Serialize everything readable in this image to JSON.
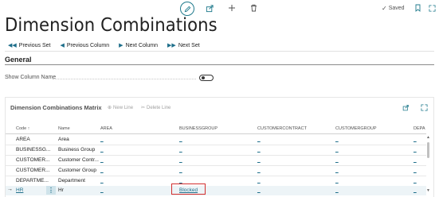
{
  "header": {
    "title": "Dimension Combinations",
    "saved_label": "Saved"
  },
  "actions": {
    "previous_set": "Previous Set",
    "previous_column": "Previous Column",
    "next_column": "Next Column",
    "next_set": "Next Set"
  },
  "general": {
    "section_title": "General",
    "show_column_name_label": "Show Column Name",
    "show_column_name_value": false
  },
  "matrix": {
    "title": "Dimension Combinations Matrix",
    "new_line": "New Line",
    "delete_line": "Delete Line",
    "columns": {
      "code": "Code ↑",
      "name": "Name",
      "area": "AREA",
      "businessgroup": "BUSINESSGROUP",
      "customercontract": "CUSTOMERCONTRACT",
      "customergroup": "CUSTOMERGROUP",
      "department": "DEPA"
    },
    "rows": [
      {
        "code": "AREA",
        "name": "Area",
        "area": "_",
        "bg": "_",
        "cc": "_",
        "cg": "_",
        "dep": "_"
      },
      {
        "code": "BUSINESSG...",
        "name": "Business Group",
        "area": "_",
        "bg": "_",
        "cc": "_",
        "cg": "_",
        "dep": "_"
      },
      {
        "code": "CUSTOMER...",
        "name": "Customer Contr...",
        "area": "_",
        "bg": "_",
        "cc": "_",
        "cg": "_",
        "dep": "_"
      },
      {
        "code": "CUSTOMER...",
        "name": "Customer Group",
        "area": "_",
        "bg": "_",
        "cc": "_",
        "cg": "_",
        "dep": "_"
      },
      {
        "code": "DEPARTME...",
        "name": "Department",
        "area": "_",
        "bg": "_",
        "cc": "_",
        "cg": "_",
        "dep": "_"
      },
      {
        "code": "HR",
        "name": "Hr",
        "area": "_",
        "bg": "Blocked",
        "cc": "_",
        "cg": "_",
        "dep": "_"
      }
    ],
    "row_menu": "⋮",
    "selected_arrow": "→"
  }
}
